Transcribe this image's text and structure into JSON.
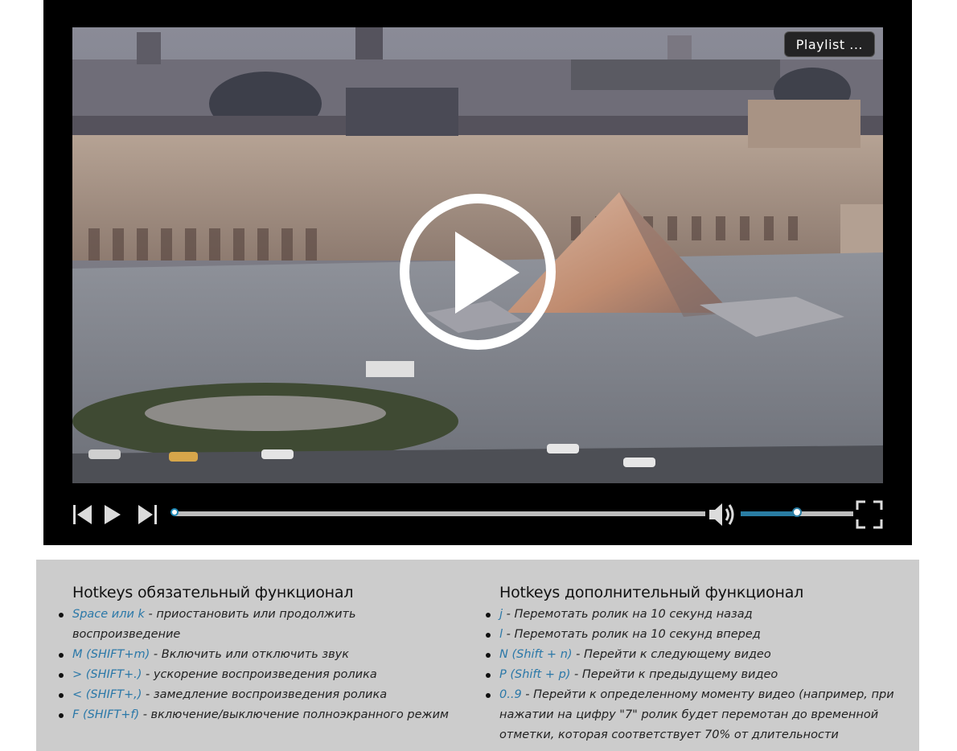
{
  "player": {
    "playlist_label": "Playlist ...",
    "progress_fraction": 0.0,
    "volume_fraction": 0.5,
    "accent_color": "#2a7da3",
    "icons": [
      "previous-icon",
      "play-icon",
      "next-icon",
      "volume-icon",
      "fullscreen-icon"
    ]
  },
  "hotkeys": {
    "required": {
      "title": "Hotkeys обязательный функционал",
      "items": [
        {
          "key": "Space или k",
          "desc": " - приостановить или продолжить",
          "desc2": "воспроизведение"
        },
        {
          "key": "M (SHIFT+m)",
          "desc": " - Включить или отключить звук"
        },
        {
          "key": "> (SHIFT+.)",
          "desc": " - ускорение воспроизведения ролика"
        },
        {
          "key": "< (SHIFT+,)",
          "desc": " - замедление воспроизведения ролика"
        },
        {
          "key": "F (SHIFT+f)",
          "desc": " - включение/выключение полноэкранного режим"
        }
      ]
    },
    "extra": {
      "title": "Hotkeys дополнительный функционал",
      "items": [
        {
          "key": "j",
          "desc": " - Перемотать ролик на 10 секунд назад"
        },
        {
          "key": "l",
          "desc": " - Перемотать ролик на 10 секунд вперед"
        },
        {
          "key": "N (Shift + n)",
          "desc": " - Перейти к следующему видео"
        },
        {
          "key": "P (Shift + p)",
          "desc": " - Перейти к предыдущему видео"
        },
        {
          "key": "0..9",
          "desc": " - Перейти к определенному моменту видео (например, при",
          "desc2": "нажатии на цифру \"7\" ролик будет перемотан до временной",
          "desc3": "отметки, которая соответствует 70% от длительности"
        }
      ]
    }
  }
}
